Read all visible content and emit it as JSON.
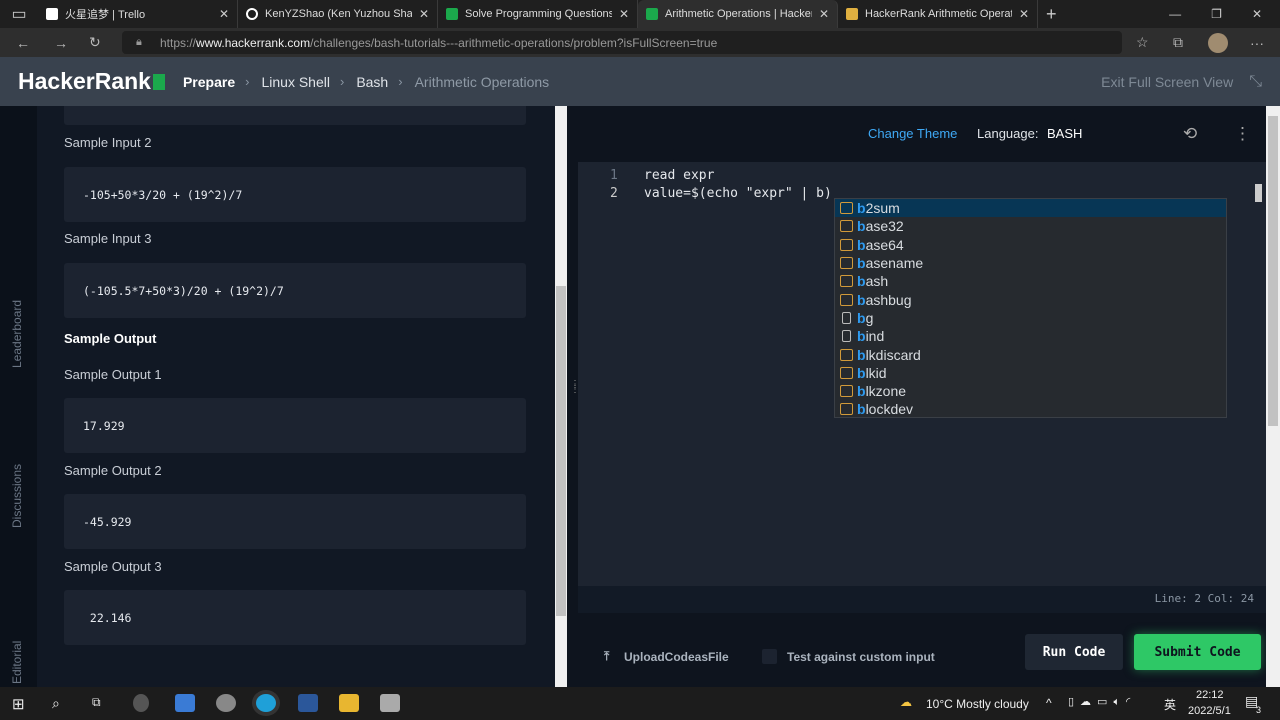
{
  "browser": {
    "tabs": [
      {
        "title": "火星追梦 | Trello",
        "favicon": "trello-icon",
        "color": "#ffffff"
      },
      {
        "title": "KenYZShao (Ken Yuzhou Shao)",
        "favicon": "github-icon",
        "color": "#ffffff"
      },
      {
        "title": "Solve Programming Questions |",
        "favicon": "hackerrank-icon",
        "color": "#1ba94c"
      },
      {
        "title": "Arithmetic Operations | HackerR",
        "favicon": "hackerrank-icon",
        "color": "#1ba94c"
      },
      {
        "title": "HackerRank Arithmetic Operatio",
        "favicon": "page-icon",
        "color": "#e0b040"
      }
    ],
    "url_prefix": "https://",
    "url_host": "www.hackerrank.com",
    "url_path": "/challenges/bash-tutorials---arithmetic-operations/problem?isFullScreen=true"
  },
  "header": {
    "logo": "HackerRank",
    "breadcrumbs": [
      "Prepare",
      "Linux Shell",
      "Bash",
      "Arithmetic Operations"
    ],
    "exit_fullscreen": "Exit Full Screen View"
  },
  "rail": [
    "Leaderboard",
    "Discussions",
    "Editorial"
  ],
  "problem": {
    "sample_input_2_label": "Sample Input 2",
    "sample_input_2": "-105+50*3/20 + (19^2)/7",
    "sample_input_3_label": "Sample Input 3",
    "sample_input_3": "(-105.5*7+50*3)/20 + (19^2)/7",
    "sample_output_heading": "Sample Output",
    "sample_output_1_label": "Sample Output 1",
    "sample_output_1": "17.929",
    "sample_output_2_label": "Sample Output 2",
    "sample_output_2": "-45.929",
    "sample_output_3_label": "Sample Output 3",
    "sample_output_3": " 22.146"
  },
  "editor": {
    "change_theme": "Change Theme",
    "language_label": "Language:",
    "language": "BASH",
    "lines": [
      {
        "n": "1",
        "code": "read expr"
      },
      {
        "n": "2",
        "code": "value=$(echo \"expr\" | b)"
      }
    ],
    "autocomplete": [
      {
        "prefix": "b",
        "rest": "2sum",
        "kind": "command"
      },
      {
        "prefix": "b",
        "rest": "ase32",
        "kind": "command"
      },
      {
        "prefix": "b",
        "rest": "ase64",
        "kind": "command"
      },
      {
        "prefix": "b",
        "rest": "asename",
        "kind": "command"
      },
      {
        "prefix": "b",
        "rest": "ash",
        "kind": "command"
      },
      {
        "prefix": "b",
        "rest": "ashbug",
        "kind": "command"
      },
      {
        "prefix": "b",
        "rest": "g",
        "kind": "keyword"
      },
      {
        "prefix": "b",
        "rest": "ind",
        "kind": "keyword"
      },
      {
        "prefix": "b",
        "rest": "lkdiscard",
        "kind": "command"
      },
      {
        "prefix": "b",
        "rest": "lkid",
        "kind": "command"
      },
      {
        "prefix": "b",
        "rest": "lkzone",
        "kind": "command"
      },
      {
        "prefix": "b",
        "rest": "lockdev",
        "kind": "command"
      }
    ],
    "status": "Line: 2 Col: 24",
    "upload": "UploadCodeasFile",
    "custom_input": "Test against custom input",
    "run": "Run Code",
    "submit": "Submit Code"
  },
  "taskbar": {
    "weather": "10°C  Mostly cloudy",
    "ime": "英",
    "time": "22:12",
    "date": "2022/5/1",
    "notifications": "3"
  },
  "colors": {
    "accent": "#1ba94c",
    "link": "#3fa9f5"
  }
}
